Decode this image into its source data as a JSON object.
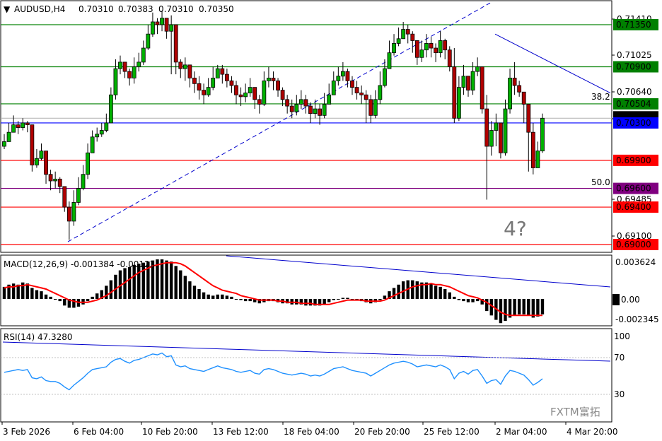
{
  "header": {
    "symbol": "AUDUSD,H4",
    "open": "0.70310",
    "high": "0.70383",
    "low": "0.70310",
    "close": "0.70350"
  },
  "price_scale": {
    "ticks": [
      "0.71410",
      "0.71025",
      "0.70640",
      "0.70350",
      "0.69485",
      "0.69100"
    ],
    "levels": [
      {
        "label": "0.71350",
        "value": 0.7135,
        "color": "#008000"
      },
      {
        "label": "0.70900",
        "value": 0.709,
        "color": "#008000"
      },
      {
        "label": "0.70504",
        "value": 0.70504,
        "color": "#008000"
      },
      {
        "label": "0.70300",
        "value": 0.703,
        "color": "#0000ff"
      },
      {
        "label": "0.69900",
        "value": 0.699,
        "color": "#ff0000"
      },
      {
        "label": "0.69600",
        "value": 0.696,
        "color": "#800080"
      },
      {
        "label": "0.69400",
        "value": 0.694,
        "color": "#ff0000"
      },
      {
        "label": "0.69000",
        "value": 0.69,
        "color": "#ff0000"
      }
    ],
    "current": {
      "label": "0.70350",
      "value": 0.7035,
      "color": "#000000"
    }
  },
  "fib_labels": {
    "f382": "38.2",
    "f500": "50.0"
  },
  "wave_annotation": "4?",
  "macd": {
    "title": "MACD(12,26,9) -0.001384 -0.00123",
    "ticks": [
      "0.003624",
      "0.00",
      "-0.002345"
    ]
  },
  "rsi": {
    "title": "RSI(14) 47.3280",
    "ticks": [
      "100",
      "70",
      "30"
    ]
  },
  "x_axis": [
    "3 Feb 2026",
    "6 Feb 04:00",
    "10 Feb 20:00",
    "13 Feb 12:00",
    "18 Feb 04:00",
    "20 Feb 20:00",
    "25 Feb 12:00",
    "2 Mar 04:00",
    "4 Mar 20:00"
  ],
  "watermark": "FXTM富拓",
  "colors": {
    "bull": "#00b000",
    "bear": "#b00000",
    "signal": "#ff0000",
    "rsi": "#1e90ff",
    "trend": "#0000cc"
  },
  "chart_data": [
    {
      "type": "candlestick",
      "title": "AUDUSD,H4",
      "ylim": [
        0.6897,
        0.7148
      ],
      "series": [
        {
          "name": "AUDUSD",
          "close": [
            0.701,
            0.702,
            0.7028,
            0.7025,
            0.703,
            0.7028,
            0.6985,
            0.6992,
            0.7,
            0.6975,
            0.6968,
            0.697,
            0.6962,
            0.694,
            0.6925,
            0.6945,
            0.696,
            0.6975,
            0.6998,
            0.7015,
            0.7018,
            0.7022,
            0.703,
            0.706,
            0.7088,
            0.7095,
            0.7085,
            0.7078,
            0.709,
            0.7095,
            0.711,
            0.7125,
            0.7138,
            0.7135,
            0.7142,
            0.7128,
            0.7135,
            0.7095,
            0.7088,
            0.7092,
            0.7078,
            0.7072,
            0.7065,
            0.706,
            0.7068,
            0.7078,
            0.7088,
            0.7082,
            0.7075,
            0.707,
            0.706,
            0.7058,
            0.7062,
            0.7068,
            0.7055,
            0.705,
            0.7075,
            0.7078,
            0.7075,
            0.7065,
            0.7055,
            0.7048,
            0.7042,
            0.705,
            0.7055,
            0.7048,
            0.704,
            0.7045,
            0.7038,
            0.705,
            0.706,
            0.7075,
            0.708,
            0.7085,
            0.7075,
            0.7068,
            0.7062,
            0.706,
            0.7055,
            0.7038,
            0.7055,
            0.707,
            0.7088,
            0.7105,
            0.7115,
            0.712,
            0.713,
            0.7125,
            0.7118,
            0.71,
            0.7108,
            0.7115,
            0.711,
            0.7105,
            0.7118,
            0.7108,
            0.709,
            0.7035,
            0.7068,
            0.708,
            0.7065,
            0.7085,
            0.709,
            0.7045,
            0.7005,
            0.7022,
            0.703,
            0.6998,
            0.7045,
            0.7078,
            0.707,
            0.7063,
            0.705,
            0.702,
            0.6982,
            0.7,
            0.7035
          ],
          "high": [
            0.7018,
            0.703,
            0.7038,
            0.7032,
            0.7035,
            0.7032,
            0.6998,
            0.7002,
            0.7008,
            0.6992,
            0.698,
            0.6978,
            0.6972,
            0.6955,
            0.6946,
            0.6958,
            0.6972,
            0.6985,
            0.7008,
            0.7022,
            0.7025,
            0.703,
            0.704,
            0.7068,
            0.7098,
            0.7102,
            0.7095,
            0.7088,
            0.71,
            0.7105,
            0.7118,
            0.7135,
            0.7148,
            0.7142,
            0.715,
            0.714,
            0.7145,
            0.7132,
            0.7098,
            0.71,
            0.7092,
            0.7085,
            0.708,
            0.7072,
            0.7078,
            0.709,
            0.7092,
            0.7092,
            0.7088,
            0.708,
            0.7075,
            0.7068,
            0.7072,
            0.7078,
            0.7065,
            0.706,
            0.7085,
            0.709,
            0.7085,
            0.7078,
            0.7068,
            0.706,
            0.7055,
            0.706,
            0.7065,
            0.706,
            0.7052,
            0.7055,
            0.705,
            0.7062,
            0.7072,
            0.7085,
            0.709,
            0.7095,
            0.7088,
            0.708,
            0.7075,
            0.707,
            0.7065,
            0.706,
            0.7065,
            0.7085,
            0.7098,
            0.7118,
            0.7125,
            0.7132,
            0.7138,
            0.7135,
            0.7128,
            0.7118,
            0.7118,
            0.7125,
            0.7122,
            0.7115,
            0.7128,
            0.712,
            0.7112,
            0.711,
            0.708,
            0.7092,
            0.708,
            0.7095,
            0.71,
            0.709,
            0.706,
            0.7032,
            0.704,
            0.703,
            0.7055,
            0.7088,
            0.7095,
            0.7075,
            0.7062,
            0.705,
            0.703,
            0.701,
            0.704
          ],
          "low": [
            0.7002,
            0.7012,
            0.702,
            0.7018,
            0.7022,
            0.702,
            0.6978,
            0.6982,
            0.699,
            0.6965,
            0.6958,
            0.696,
            0.6955,
            0.6935,
            0.6905,
            0.692,
            0.6942,
            0.6958,
            0.697,
            0.7005,
            0.701,
            0.7015,
            0.702,
            0.703,
            0.7055,
            0.7082,
            0.7078,
            0.707,
            0.7072,
            0.7085,
            0.7092,
            0.7108,
            0.7122,
            0.7125,
            0.7128,
            0.712,
            0.7082,
            0.7082,
            0.7078,
            0.7075,
            0.7068,
            0.7062,
            0.7055,
            0.705,
            0.7058,
            0.7065,
            0.7078,
            0.7072,
            0.7068,
            0.7062,
            0.705,
            0.7048,
            0.7052,
            0.7058,
            0.7045,
            0.704,
            0.7048,
            0.7068,
            0.7065,
            0.7058,
            0.7048,
            0.704,
            0.7035,
            0.7038,
            0.7045,
            0.704,
            0.703,
            0.7035,
            0.7028,
            0.7035,
            0.705,
            0.706,
            0.707,
            0.7075,
            0.7068,
            0.706,
            0.7055,
            0.705,
            0.703,
            0.703,
            0.7035,
            0.705,
            0.7068,
            0.709,
            0.7102,
            0.7112,
            0.712,
            0.7115,
            0.7105,
            0.7092,
            0.7095,
            0.71,
            0.71,
            0.7095,
            0.71,
            0.7098,
            0.7085,
            0.703,
            0.7032,
            0.706,
            0.7058,
            0.706,
            0.708,
            0.704,
            0.6948,
            0.6995,
            0.7005,
            0.6992,
            0.6995,
            0.704,
            0.706,
            0.7058,
            0.703,
            0.6978,
            0.6975,
            0.6985,
            0.6998
          ]
        }
      ]
    },
    {
      "type": "bar",
      "title": "MACD(12,26,9) -0.001384 -0.00123",
      "ylim": [
        -0.0025,
        0.0037
      ],
      "series": [
        {
          "name": "MACD",
          "values": [
            0.0011,
            0.0013,
            0.0014,
            0.0013,
            0.0015,
            0.0014,
            0.001,
            0.0008,
            0.0007,
            0.0004,
            0.0002,
            0.0,
            -0.0002,
            -0.0006,
            -0.0008,
            -0.0008,
            -0.0007,
            -0.0005,
            -0.0002,
            0.0002,
            0.0005,
            0.0008,
            0.0012,
            0.0017,
            0.0022,
            0.0026,
            0.0028,
            0.0029,
            0.0031,
            0.0032,
            0.0033,
            0.0034,
            0.0035,
            0.0036,
            0.0036,
            0.0035,
            0.0034,
            0.003,
            0.0026,
            0.0021,
            0.0016,
            0.0012,
            0.0009,
            0.0006,
            0.0004,
            0.0003,
            0.0004,
            0.0004,
            0.0003,
            0.0002,
            0.0,
            -0.0001,
            -0.0002,
            -0.0002,
            -0.0003,
            -0.0004,
            -0.0003,
            -0.0002,
            -0.0002,
            -0.0003,
            -0.0004,
            -0.0004,
            -0.0005,
            -0.0005,
            -0.0005,
            -0.0006,
            -0.0006,
            -0.0006,
            -0.0006,
            -0.0005,
            -0.0003,
            -0.0001,
            0.0,
            0.0001,
            0.0001,
            0.0,
            -0.0001,
            -0.0002,
            -0.0003,
            -0.0004,
            -0.0003,
            -0.0001,
            0.0003,
            0.0007,
            0.001,
            0.0013,
            0.0016,
            0.0017,
            0.0017,
            0.0016,
            0.0015,
            0.0015,
            0.0014,
            0.0012,
            0.0011,
            0.0009,
            0.0006,
            0.0002,
            -0.0001,
            -0.0002,
            -0.0003,
            -0.0003,
            -0.0002,
            -0.0005,
            -0.0011,
            -0.0015,
            -0.0019,
            -0.0022,
            -0.002,
            -0.0017,
            -0.0015,
            -0.0014,
            -0.0014,
            -0.0015,
            -0.0017,
            -0.0016,
            -0.0014
          ]
        },
        {
          "name": "Signal",
          "values": [
            0.001,
            0.0011,
            0.0011,
            0.0012,
            0.0012,
            0.0013,
            0.0012,
            0.0011,
            0.001,
            0.0009,
            0.0007,
            0.0005,
            0.0003,
            0.0001,
            -0.0001,
            -0.0002,
            -0.0003,
            -0.0003,
            -0.0003,
            -0.0002,
            -0.0001,
            0.0001,
            0.0003,
            0.0006,
            0.0009,
            0.0012,
            0.0015,
            0.0018,
            0.0021,
            0.0024,
            0.0026,
            0.0028,
            0.003,
            0.0031,
            0.0032,
            0.0033,
            0.0033,
            0.0033,
            0.0032,
            0.003,
            0.0027,
            0.0024,
            0.0021,
            0.0018,
            0.0015,
            0.0012,
            0.001,
            0.0008,
            0.0007,
            0.0006,
            0.0005,
            0.0003,
            0.0002,
            0.0001,
            0.0,
            -0.0001,
            -0.0001,
            -0.0001,
            -0.0001,
            -0.0002,
            -0.0002,
            -0.0003,
            -0.0003,
            -0.0003,
            -0.0004,
            -0.0004,
            -0.0004,
            -0.0005,
            -0.0005,
            -0.0005,
            -0.0005,
            -0.0004,
            -0.0003,
            -0.0002,
            -0.0001,
            -0.0001,
            -0.0001,
            -0.0001,
            -0.0002,
            -0.0002,
            -0.0002,
            -0.0002,
            -0.0001,
            0.0001,
            0.0003,
            0.0005,
            0.0007,
            0.0009,
            0.0011,
            0.0012,
            0.0013,
            0.0013,
            0.0014,
            0.0013,
            0.0013,
            0.0012,
            0.0011,
            0.0009,
            0.0007,
            0.0005,
            0.0003,
            0.0002,
            0.0001,
            -0.0001,
            -0.0003,
            -0.0006,
            -0.0009,
            -0.0012,
            -0.0014,
            -0.0015,
            -0.0015,
            -0.0015,
            -0.0015,
            -0.0015,
            -0.0015,
            -0.0015,
            -0.0015
          ]
        }
      ]
    },
    {
      "type": "line",
      "title": "RSI(14) 47.3280",
      "ylim": [
        0,
        100
      ],
      "series": [
        {
          "name": "RSI",
          "values": [
            54,
            55,
            56,
            57,
            56,
            57,
            48,
            47,
            49,
            45,
            44,
            44,
            42,
            38,
            35,
            40,
            44,
            48,
            53,
            57,
            58,
            59,
            60,
            65,
            68,
            69,
            66,
            64,
            67,
            68,
            70,
            72,
            74,
            73,
            75,
            71,
            72,
            62,
            60,
            61,
            58,
            57,
            56,
            55,
            57,
            59,
            61,
            59,
            58,
            57,
            55,
            54,
            55,
            56,
            53,
            52,
            57,
            58,
            57,
            55,
            53,
            52,
            51,
            52,
            53,
            52,
            50,
            51,
            50,
            52,
            55,
            58,
            59,
            60,
            58,
            56,
            55,
            54,
            53,
            50,
            53,
            56,
            59,
            62,
            64,
            65,
            66,
            65,
            63,
            60,
            61,
            62,
            61,
            60,
            62,
            60,
            57,
            47,
            53,
            55,
            52,
            56,
            57,
            50,
            42,
            45,
            46,
            41,
            50,
            56,
            55,
            53,
            51,
            46,
            40,
            43,
            47
          ]
        }
      ]
    }
  ]
}
